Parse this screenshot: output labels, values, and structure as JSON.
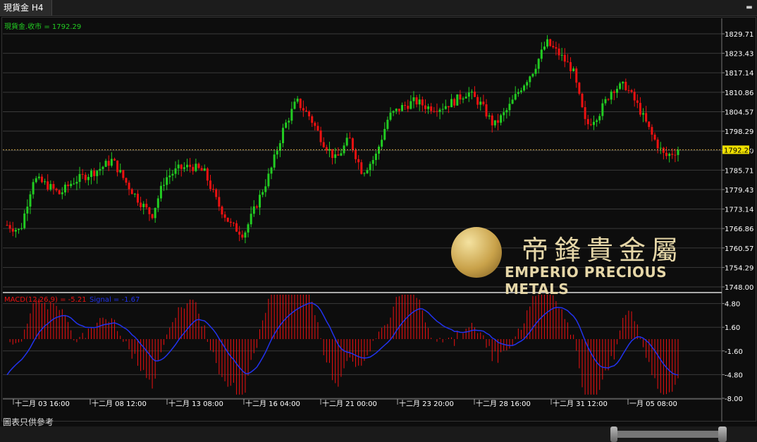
{
  "window": {
    "tab_title": "現貨金 H4"
  },
  "price_panel": {
    "legend": "現貨金.收市 = 1792.29",
    "current_price": "1792.29",
    "y_ticks": [
      "1829.71",
      "1823.43",
      "1817.14",
      "1810.86",
      "1804.57",
      "1798.29",
      "1792.00",
      "1785.71",
      "1779.43",
      "1773.14",
      "1766.86",
      "1760.57",
      "1754.29",
      "1748.00"
    ],
    "colors": {
      "up": "#22cc22",
      "down": "#ee1111",
      "price_line": "#c8a048"
    }
  },
  "macd_panel": {
    "legend_macd": "MACD(12,26,9) = -5.21",
    "legend_signal": "Signal = -1.67",
    "y_ticks": [
      "4.80",
      "1.60",
      "-1.60",
      "-4.80",
      "-8.00"
    ],
    "colors": {
      "histogram": "#ee1111",
      "signal": "#2233ee"
    }
  },
  "x_ticks": [
    "十二月 03 16:00",
    "十二月 08 12:00",
    "十二月 13 08:00",
    "十二月 16 04:00",
    "十二月 21 00:00",
    "十二月 23 20:00",
    "十二月 28 16:00",
    "十二月 31 12:00",
    "一月 05 08:00"
  ],
  "footer_note": "圖表只供參考",
  "watermark": {
    "chinese": "帝鋒貴金屬",
    "english": "EMPERIO PRECIOUS METALS"
  },
  "chart_data": [
    {
      "type": "candlestick",
      "title": "現貨金 H4",
      "ylim": [
        1748.0,
        1832.0
      ],
      "series": [
        {
          "name": "現貨金.收市",
          "last": 1792.29
        }
      ],
      "approx_close_path": [
        1768,
        1766,
        1783,
        1781,
        1778,
        1782,
        1784,
        1786,
        1789,
        1782,
        1776,
        1771,
        1783,
        1786,
        1787,
        1785,
        1775,
        1768,
        1765,
        1775,
        1785,
        1799,
        1808,
        1803,
        1795,
        1789,
        1796,
        1785,
        1790,
        1803,
        1806,
        1808,
        1806,
        1806,
        1808,
        1811,
        1807,
        1800,
        1805,
        1812,
        1818,
        1827,
        1823,
        1818,
        1800,
        1804,
        1812,
        1813,
        1806,
        1797,
        1790,
        1792.29
      ]
    },
    {
      "type": "bar",
      "title": "MACD(12,26,9)",
      "series": [
        {
          "name": "MACD(12,26,9)",
          "last": -5.21
        },
        {
          "name": "Signal",
          "last": -1.67
        }
      ],
      "ylim": [
        -8.0,
        6.0
      ]
    }
  ]
}
